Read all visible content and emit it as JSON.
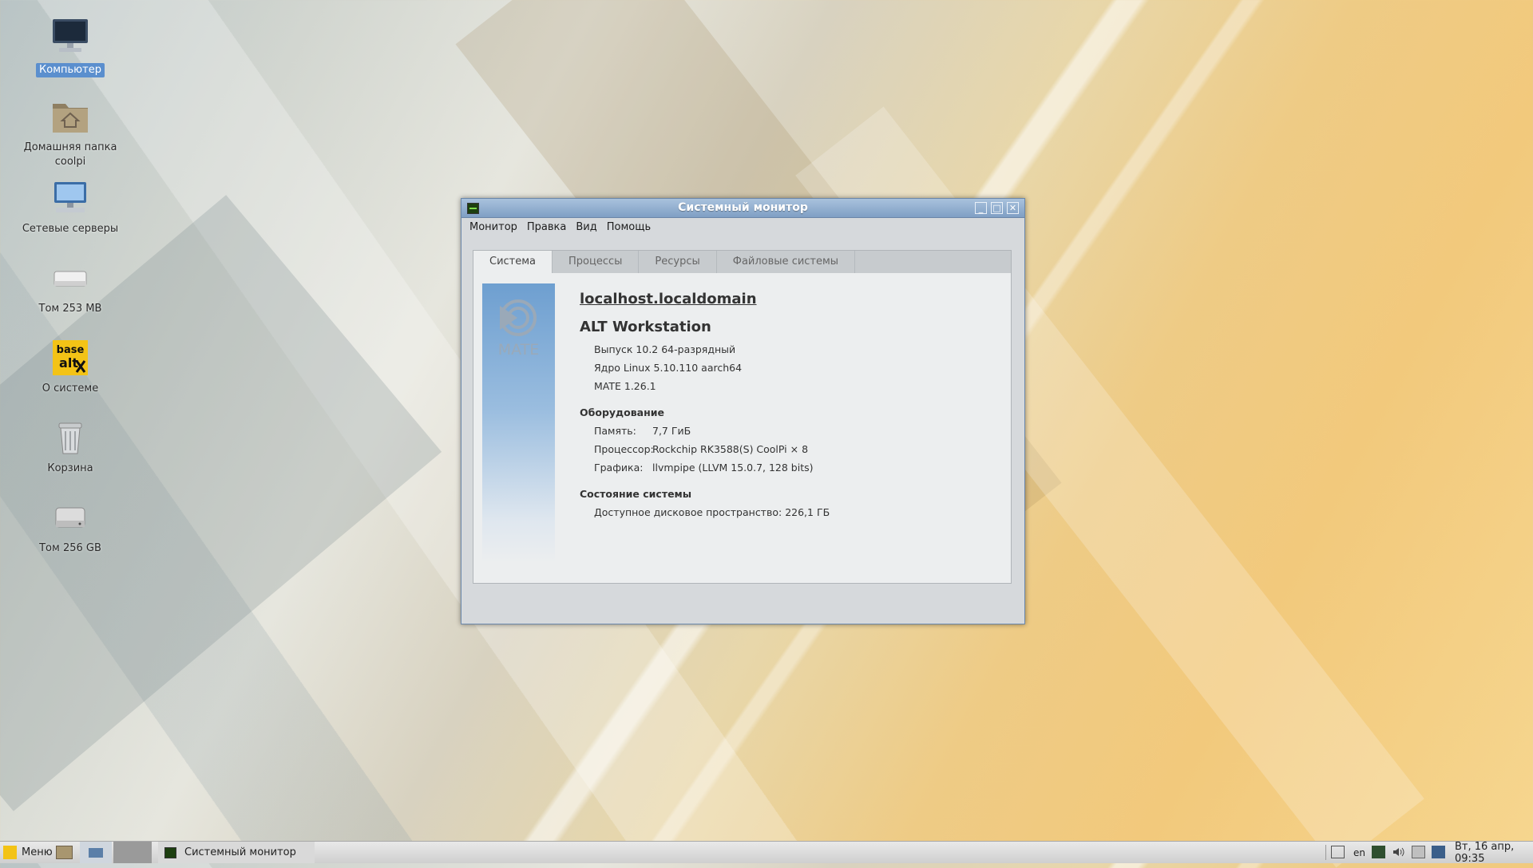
{
  "desktop": {
    "icons": [
      {
        "label": "Компьютер",
        "icon": "computer-icon",
        "selected": true
      },
      {
        "label": "Домашняя папка",
        "label2": "coolpi",
        "icon": "home-folder-icon"
      },
      {
        "label": "Сетевые серверы",
        "icon": "network-servers-icon"
      },
      {
        "label": "Том 253 MB",
        "icon": "drive-icon"
      },
      {
        "label": "О системе",
        "icon": "basealt-logo-icon"
      },
      {
        "label": "Корзина",
        "icon": "trash-icon"
      },
      {
        "label": "Том 256 GB",
        "icon": "drive-icon"
      }
    ]
  },
  "window": {
    "title": "Системный монитор",
    "menu": [
      "Монитор",
      "Правка",
      "Вид",
      "Помощь"
    ],
    "tabs": [
      "Система",
      "Процессы",
      "Ресурсы",
      "Файловые системы"
    ],
    "active_tab": "Система",
    "banner_text": "MATE",
    "hostname": "localhost.localdomain",
    "distro": "ALT Workstation",
    "release": "Выпуск 10.2 64-разрядный",
    "kernel": "Ядро Linux 5.10.110 aarch64",
    "mate_version": "MATE 1.26.1",
    "hardware": {
      "heading": "Оборудование",
      "memory_label": "Память:",
      "memory_value": "7,7 ГиБ",
      "cpu_label": "Процессор:",
      "cpu_value": "Rockchip RK3588(S) CoolPi × 8",
      "gpu_label": "Графика:",
      "gpu_value": "llvmpipe (LLVM 15.0.7, 128 bits)"
    },
    "status": {
      "heading": "Состояние системы",
      "disk_label": "Доступное дисковое пространство:",
      "disk_value": "226,1 ГБ"
    }
  },
  "taskbar": {
    "menu_label": "Меню",
    "window_button": "Системный монитор",
    "keyboard_layout": "en",
    "clock": "Вт, 16 апр, 09:35"
  },
  "colors": {
    "titlebar": "#8fadd0",
    "selection": "#5b8fce",
    "banner": "#6e9fd0"
  }
}
